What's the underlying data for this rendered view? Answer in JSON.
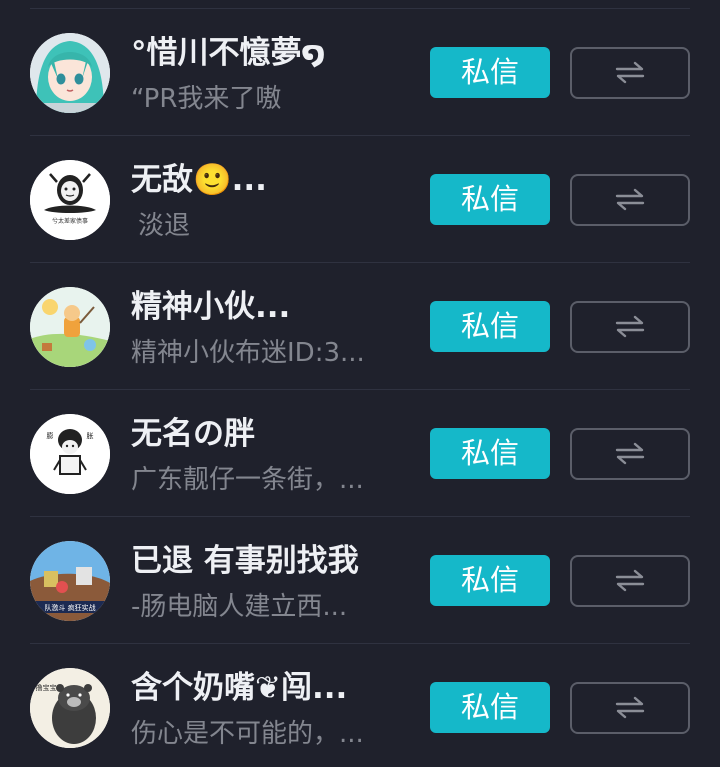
{
  "users": [
    {
      "name": "°惜川不憶夢໑",
      "bio": "“PR我来了嗷",
      "avatar_icon": "anime-girl-teal-hair-icon"
    },
    {
      "name": "无敌🙂...",
      "bio": "淡退",
      "avatar_icon": "meme-face-icon"
    },
    {
      "name": "精神小伙...",
      "bio": "精神小伙布迷ID:3...",
      "avatar_icon": "cartoon-scene-icon"
    },
    {
      "name": "无名の胖",
      "bio": "广东靓仔一条街，...",
      "avatar_icon": "meme-panda-icon"
    },
    {
      "name": "已退 有事别找我",
      "bio": "-肠电脑人建立西...",
      "avatar_icon": "game-scene-icon"
    },
    {
      "name": "含个奶嘴❦闯...",
      "bio": "伤心是不可能的，...",
      "avatar_icon": "bear-sketch-icon"
    }
  ],
  "buttons": {
    "message_label": "私信",
    "mutual_follow_icon": "mutual-follow-icon"
  },
  "colors": {
    "background": "#1f212c",
    "accent": "#15b8c9",
    "name_text": "#eef0f4",
    "bio_text": "#83868f",
    "outline": "#5b5e69"
  },
  "avatar_texts": {
    "meme_face_caption": "兮太差家债事",
    "meme_panda_left": "膨",
    "meme_panda_right": "胀",
    "game_banner": "队激斗 疯狂实战",
    "bear_label": "撸宝宝"
  }
}
